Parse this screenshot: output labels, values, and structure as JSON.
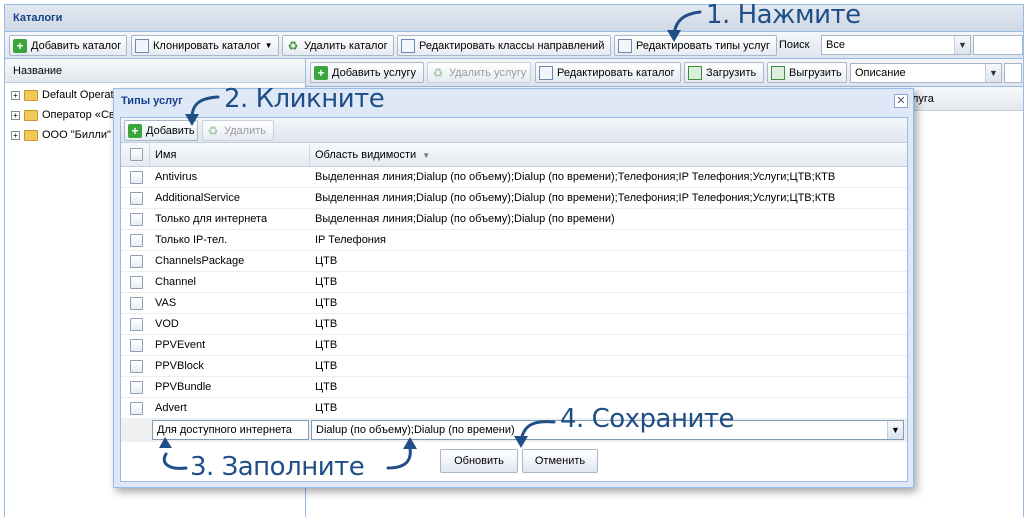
{
  "window": {
    "title": "Каталоги"
  },
  "toolbar": {
    "add_catalog": "Добавить каталог",
    "clone_catalog": "Клонировать каталог",
    "delete_catalog": "Удалить каталог",
    "edit_direction_classes": "Редактировать классы направлений",
    "edit_service_types": "Редактировать типы услуг",
    "search_label": "Поиск",
    "search_select_value": "Все"
  },
  "tree": {
    "header": "Название",
    "items": [
      {
        "label": "Default Operat"
      },
      {
        "label": "Оператор «Св"
      },
      {
        "label": "ООО \"Билли\""
      }
    ]
  },
  "right_toolbar": {
    "add_service": "Добавить услугу",
    "delete_service": "Удалить услугу",
    "edit_catalog": "Редактировать каталог",
    "load": "Загрузить",
    "unload": "Выгрузить",
    "field_select_value": "Описание",
    "grid_header_partial": "луга"
  },
  "modal": {
    "title": "Типы услуг",
    "add_button": "Добавить",
    "delete_button": "Удалить",
    "columns": {
      "name": "Имя",
      "scope": "Область видимости"
    },
    "rows": [
      {
        "name": "Antivirus",
        "scope": "Выделенная линия;Dialup (по объему);Dialup (по времени);Телефония;IP Телефония;Услуги;ЦТВ;КТВ"
      },
      {
        "name": "AdditionalService",
        "scope": "Выделенная линия;Dialup (по объему);Dialup (по времени);Телефония;IP Телефония;Услуги;ЦТВ;КТВ"
      },
      {
        "name": "Только для интернета",
        "scope": "Выделенная линия;Dialup (по объему);Dialup (по времени)"
      },
      {
        "name": "Только IP-тел.",
        "scope": "IP Телефония"
      },
      {
        "name": "ChannelsPackage",
        "scope": "ЦТВ"
      },
      {
        "name": "Channel",
        "scope": "ЦТВ"
      },
      {
        "name": "VAS",
        "scope": "ЦТВ"
      },
      {
        "name": "VOD",
        "scope": "ЦТВ"
      },
      {
        "name": "PPVEvent",
        "scope": "ЦТВ"
      },
      {
        "name": "PPVBlock",
        "scope": "ЦТВ"
      },
      {
        "name": "PPVBundle",
        "scope": "ЦТВ"
      },
      {
        "name": "Advert",
        "scope": "ЦТВ"
      }
    ],
    "edit_row": {
      "name_value": "Для доступного интернета",
      "scope_value": "Dialup (по объему);Dialup (по времени)"
    },
    "save_button": "Обновить",
    "cancel_button": "Отменить"
  },
  "annotations": {
    "step1": "1. Нажмите",
    "step2": "2. Кликните",
    "step3": "3. Заполните",
    "step4": "4. Сохраните",
    "color": "#1f4f86"
  }
}
